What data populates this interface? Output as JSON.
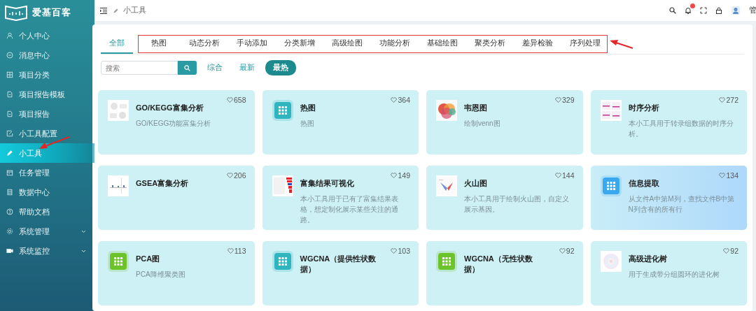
{
  "sidebar": {
    "logo_text": "爱基百客",
    "items": [
      {
        "label": "个人中心",
        "selected": false,
        "expandable": false
      },
      {
        "label": "消息中心",
        "selected": false,
        "expandable": false
      },
      {
        "label": "项目分类",
        "selected": false,
        "expandable": false
      },
      {
        "label": "项目报告模板",
        "selected": false,
        "expandable": false
      },
      {
        "label": "项目报告",
        "selected": false,
        "expandable": false
      },
      {
        "label": "小工具配置",
        "selected": false,
        "expandable": false
      },
      {
        "label": "小工具",
        "selected": true,
        "expandable": false
      },
      {
        "label": "任务管理",
        "selected": false,
        "expandable": false
      },
      {
        "label": "数据中心",
        "selected": false,
        "expandable": false
      },
      {
        "label": "帮助文档",
        "selected": false,
        "expandable": false
      },
      {
        "label": "系统管理",
        "selected": false,
        "expandable": true
      },
      {
        "label": "系统监控",
        "selected": false,
        "expandable": true
      }
    ]
  },
  "top_bar": {
    "breadcrumb": "小工具",
    "user": "管"
  },
  "tabs": [
    {
      "label": "全部",
      "selected": true
    },
    {
      "label": "热图",
      "selected": false
    },
    {
      "label": "动态分析",
      "selected": false
    },
    {
      "label": "手动添加",
      "selected": false
    },
    {
      "label": "分类新增",
      "selected": false
    },
    {
      "label": "高级绘图",
      "selected": false
    },
    {
      "label": "功能分析",
      "selected": false
    },
    {
      "label": "基础绘图",
      "selected": false
    },
    {
      "label": "聚类分析",
      "selected": false
    },
    {
      "label": "差异检验",
      "selected": false
    },
    {
      "label": "序列处理",
      "selected": false
    }
  ],
  "search": {
    "placeholder": "搜索"
  },
  "sort_options": [
    {
      "label": "综合",
      "selected": false
    },
    {
      "label": "最新",
      "selected": false
    },
    {
      "label": "最热",
      "selected": true
    }
  ],
  "cards": [
    {
      "title": "GO/KEGG富集分析",
      "description": "GO/KEGG功能富集分析",
      "likes": "658",
      "hovered": false
    },
    {
      "title": "热图",
      "description": "热图",
      "likes": "364",
      "icon": {
        "kind": "app",
        "color": "#2fb5c0"
      },
      "hovered": false
    },
    {
      "title": "韦恩图",
      "description": "绘制venn图",
      "likes": "329",
      "hovered": false
    },
    {
      "title": "时序分析",
      "description": "本小工具用于转录组数据的时序分析。",
      "likes": "272",
      "hovered": false
    },
    {
      "title": "GSEA富集分析",
      "likes": "206",
      "hovered": false
    },
    {
      "title": "富集结果可视化",
      "description": "本小工具用于已有了富集结果表格，想定制化展示某些关注的通路。",
      "likes": "149",
      "hovered": false
    },
    {
      "title": "火山图",
      "description": "本小工具用于绘制火山图，自定义展示基因。",
      "likes": "144",
      "hovered": false
    },
    {
      "title": "信息提取",
      "description": "从文件A中第M列，查找文件B中第N列含有的所有行",
      "likes": "134",
      "icon": {
        "kind": "app",
        "color": "#3aa8ee"
      },
      "hovered": true
    },
    {
      "title": "PCA图",
      "description": "PCA降维聚类图",
      "likes": "113",
      "icon": {
        "kind": "app",
        "color": "#6cc42a"
      },
      "hovered": false
    },
    {
      "title": "WGCNA（提供性状数据）",
      "likes": "103",
      "icon": {
        "kind": "app",
        "color": "#2fb5c0"
      },
      "hovered": false
    },
    {
      "title": "WGCNA（无性状数据）",
      "likes": "92",
      "icon": {
        "kind": "app",
        "color": "#6cc42a"
      },
      "hovered": false
    },
    {
      "title": "高级进化树",
      "description": "用于生成带分组圆环的进化树",
      "likes": "92",
      "hovered": false
    }
  ],
  "annotations": [
    {
      "kind": "tab-box"
    },
    {
      "kind": "tab-arrow"
    },
    {
      "kind": "sidebar-arrow"
    }
  ]
}
